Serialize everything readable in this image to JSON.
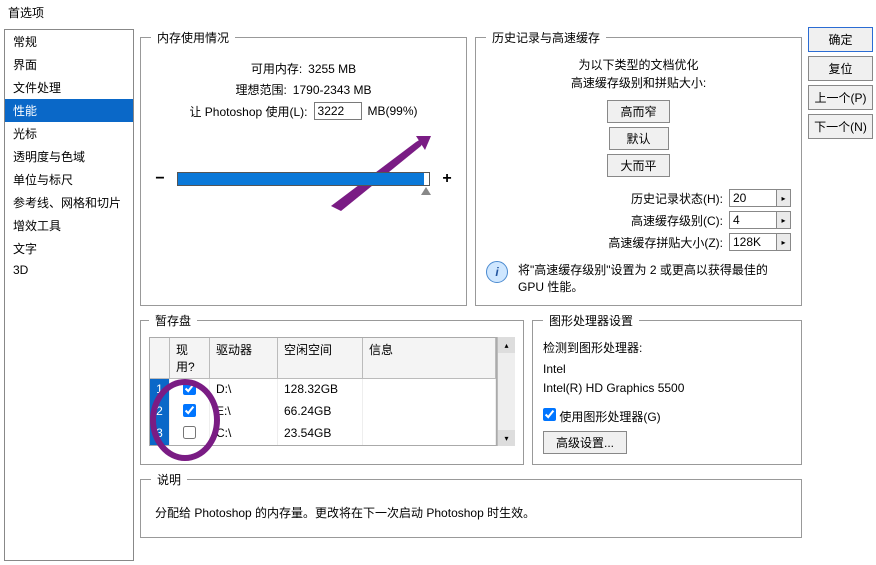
{
  "title": "首选项",
  "sidebar": {
    "items": [
      {
        "label": "常规"
      },
      {
        "label": "界面"
      },
      {
        "label": "文件处理"
      },
      {
        "label": "性能",
        "selected": true
      },
      {
        "label": "光标"
      },
      {
        "label": "透明度与色域"
      },
      {
        "label": "单位与标尺"
      },
      {
        "label": "参考线、网格和切片"
      },
      {
        "label": "增效工具"
      },
      {
        "label": "文字"
      },
      {
        "label": "3D"
      }
    ]
  },
  "memory": {
    "legend": "内存使用情况",
    "available_label": "可用内存:",
    "available_value": "3255 MB",
    "ideal_label": "理想范围:",
    "ideal_value": "1790-2343 MB",
    "let_label": "让 Photoshop 使用(L):",
    "let_value": "3222",
    "let_unit": "MB(99%)",
    "minus": "−",
    "plus": "+"
  },
  "history": {
    "legend": "历史记录与高速缓存",
    "text1": "为以下类型的文档优化",
    "text2": "高速缓存级别和拼贴大小:",
    "btn_tall": "高而窄",
    "btn_default": "默认",
    "btn_wide": "大而平",
    "states_label": "历史记录状态(H):",
    "states_value": "20",
    "levels_label": "高速缓存级别(C):",
    "levels_value": "4",
    "tile_label": "高速缓存拼贴大小(Z):",
    "tile_value": "128K",
    "info": "将\"高速缓存级别\"设置为 2 或更高以获得最佳的 GPU 性能。"
  },
  "disks": {
    "legend": "暂存盘",
    "head_active": "现用?",
    "head_drive": "驱动器",
    "head_free": "空闲空间",
    "head_info": "信息",
    "rows": [
      {
        "idx": "1",
        "active": true,
        "drive": "D:\\",
        "free": "128.32GB"
      },
      {
        "idx": "2",
        "active": true,
        "drive": "E:\\",
        "free": "66.24GB"
      },
      {
        "idx": "3",
        "active": false,
        "drive": "C:\\",
        "free": "23.54GB"
      }
    ]
  },
  "gpu": {
    "legend": "图形处理器设置",
    "detected": "检测到图形处理器:",
    "line1": "Intel",
    "line2": "Intel(R) HD Graphics 5500",
    "use_label": "使用图形处理器(G)",
    "use_checked": true,
    "adv_btn": "高级设置..."
  },
  "desc": {
    "legend": "说明",
    "text": "分配给 Photoshop 的内存量。更改将在下一次启动 Photoshop 时生效。"
  },
  "buttons": {
    "ok": "确定",
    "reset": "复位",
    "prev": "上一个(P)",
    "next": "下一个(N)"
  }
}
